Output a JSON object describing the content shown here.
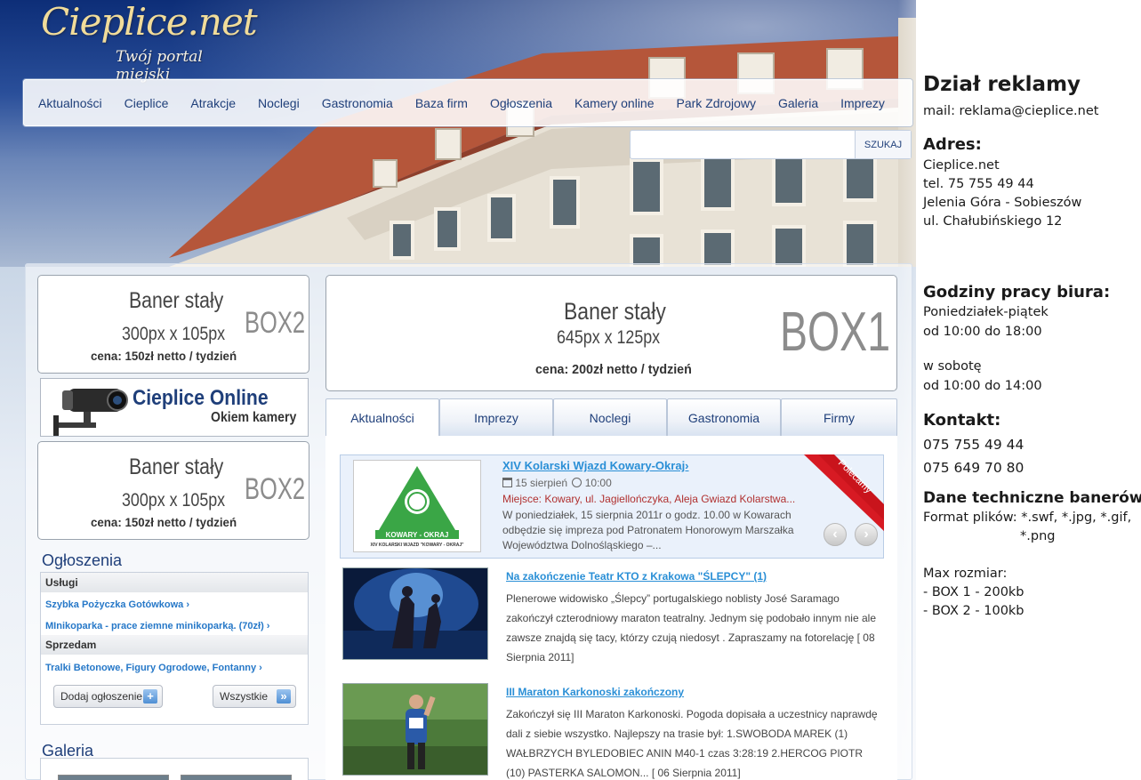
{
  "logo": {
    "main": "Cieplice.net",
    "sub": "Twój portal miejski"
  },
  "nav": [
    "Aktualności",
    "Cieplice",
    "Atrakcje",
    "Noclegi",
    "Gastronomia",
    "Baza firm",
    "Ogłoszenia",
    "Kamery online",
    "Park Zdrojowy",
    "Galeria",
    "Imprezy"
  ],
  "search": {
    "value": "",
    "placeholder": "",
    "button": "SZUKAJ"
  },
  "box2": {
    "title": "Baner stały",
    "size": "300px x 105px",
    "price": "cena: 150zł netto / tydzień",
    "label": "BOX2"
  },
  "box1": {
    "title": "Baner stały",
    "size": "645px x 125px",
    "price": "cena: 200zł netto / tydzień",
    "label": "BOX1"
  },
  "cam_banner": {
    "title": "Cieplice Online",
    "subtitle": "Okiem kamery"
  },
  "ogloszenia": {
    "title": "Ogłoszenia",
    "cat1": "Usługi",
    "link1": "Szybka Pożyczka Gotówkowa ›",
    "link2": "MInikoparka - prace ziemne minikoparką. (70zł) ›",
    "cat2": "Sprzedam",
    "link3": "Tralki Betonowe, Figury Ogrodowe, Fontanny ›",
    "add_btn": "Dodaj ogłoszenie",
    "all_btn": "Wszystkie"
  },
  "galeria": {
    "title": "Galeria"
  },
  "tabs": [
    "Aktualności",
    "Imprezy",
    "Noclegi",
    "Gastronomia",
    "Firmy"
  ],
  "featured": {
    "title": "XIV Kolarski Wjazd Kowary-Okraj›",
    "date": "15 sierpień",
    "time": "10:00",
    "place": "Miejsce: Kowary, ul. Jagiellończyka, Aleja Gwiazd Kolarstwa...",
    "desc": "W poniedziałek, 15 sierpnia 2011r o godz. 10.00 w Kowarach odbędzie się impreza pod Patronatem Honorowym Marszałka Województwa Dolnośląskiego –...",
    "ribbon": "Polecamy",
    "logo_text": "KOWARY - OKRAJ",
    "logo_caption": "XIV KOLARSKI WJAZD \"KOWARY - OKRAJ\""
  },
  "news": [
    {
      "title": "Na zakończenie Teatr KTO z Krakowa \"ŚLEPCY\" (1)",
      "desc": "Plenerowe widowisko „Ślepcy” portugalskiego noblisty José Saramago zakończył czterodniowy maraton teatralny. Jednym się podobało innym nie ale zawsze znajdą się tacy, którzy czują niedosyt . Zapraszamy na fotorelację [ 08 Sierpnia 2011]"
    },
    {
      "title": "III Maraton Karkonoski zakończony",
      "desc": "Zakończył się III Maraton Karkonoski. Pogoda dopisała a uczestnicy naprawdę dali z siebie wszystko. Najlepszy na trasie był: 1.SWOBODA MAREK (1) WAŁBRZYCH BYLEDOBIEC ANIN M40-1 czas 3:28:19 2.HERCOG PIOTR (10) PASTERKA SALOMON... [ 06 Sierpnia 2011]"
    }
  ],
  "ad_panel": {
    "heading": "Dział reklamy",
    "mail": "mail: reklama@cieplice.net",
    "address_h": "Adres:",
    "address": [
      "Cieplice.net",
      "tel. 75 755 49 44",
      "Jelenia Góra - Sobieszów",
      "ul. Chałubińskiego 12"
    ],
    "hours_h": "Godziny pracy biura:",
    "hours": [
      "Poniedziałek-piątek",
      "od 10:00 do 18:00",
      "",
      "w sobotę",
      "od 10:00 do 14:00"
    ],
    "contact_h": "Kontakt:",
    "contact": [
      "075 755 49 44",
      "075 649 70 80"
    ],
    "tech_h": "Dane techniczne banerów:",
    "tech": [
      "Format plików: *.swf, *.jpg, *.gif,",
      "*.png",
      "",
      "Max rozmiar:",
      "- BOX 1 - 200kb",
      "- BOX 2 - 100kb"
    ]
  }
}
